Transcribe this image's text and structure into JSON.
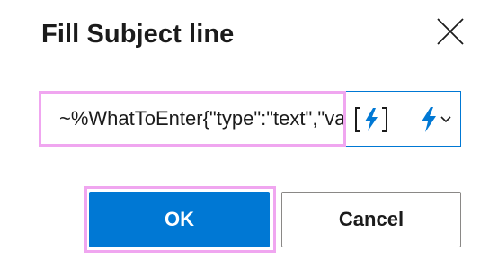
{
  "dialog": {
    "title": "Fill Subject line"
  },
  "field": {
    "value": "~%WhatToEnter{\"type\":\"text\",\"value\":\"\"}%~"
  },
  "buttons": {
    "ok_label": "OK",
    "cancel_label": "Cancel"
  },
  "icons": {
    "close": "close-icon",
    "insert_variable": "bracketed-lightning-icon",
    "variable_menu": "lightning-icon",
    "dropdown": "chevron-down-icon"
  },
  "colors": {
    "accent": "#0078d4",
    "highlight": "#f0a6f0",
    "border": "#8a8886"
  }
}
